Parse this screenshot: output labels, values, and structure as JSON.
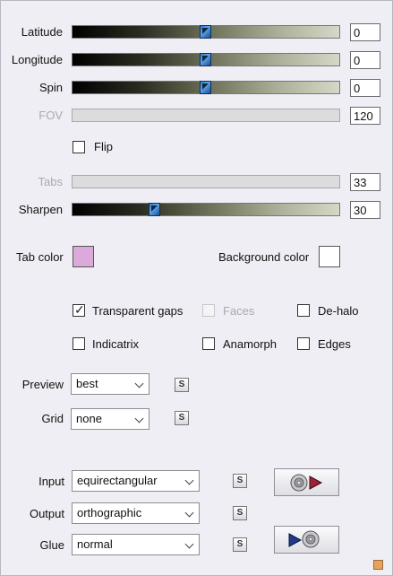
{
  "sliders": [
    {
      "label": "Latitude",
      "value": "0",
      "position": 0.5,
      "enabled": true
    },
    {
      "label": "Longitude",
      "value": "0",
      "position": 0.5,
      "enabled": true
    },
    {
      "label": "Spin",
      "value": "0",
      "position": 0.5,
      "enabled": true
    },
    {
      "label": "FOV",
      "value": "120",
      "enabled": false
    },
    {
      "label": "Tabs",
      "value": "33",
      "enabled": false
    },
    {
      "label": "Sharpen",
      "value": "30",
      "position": 0.3,
      "enabled": true
    }
  ],
  "flip": {
    "label": "Flip",
    "checked": false
  },
  "colors": {
    "tab_color_label": "Tab color",
    "tab_color": "#dbaadb",
    "background_color_label": "Background color",
    "background_color": "#ffffff"
  },
  "options": {
    "transparent_gaps": {
      "label": "Transparent gaps",
      "checked": true
    },
    "faces": {
      "label": "Faces",
      "checked": false,
      "enabled": false
    },
    "de_halo": {
      "label": "De-halo",
      "checked": false
    },
    "indicatrix": {
      "label": "Indicatrix",
      "checked": false
    },
    "anamorph": {
      "label": "Anamorph",
      "checked": false
    },
    "edges": {
      "label": "Edges",
      "checked": false
    }
  },
  "preview": {
    "label": "Preview",
    "value": "best"
  },
  "grid": {
    "label": "Grid",
    "value": "none"
  },
  "input": {
    "label": "Input",
    "value": "equirectangular"
  },
  "output": {
    "label": "Output",
    "value": "orthographic"
  },
  "glue": {
    "label": "Glue",
    "value": "normal"
  },
  "s_button_label": "S",
  "icons": {
    "disc_play": "disc-then-play-icon",
    "play_disc": "play-then-disc-icon",
    "accent": "#e8a25e"
  }
}
